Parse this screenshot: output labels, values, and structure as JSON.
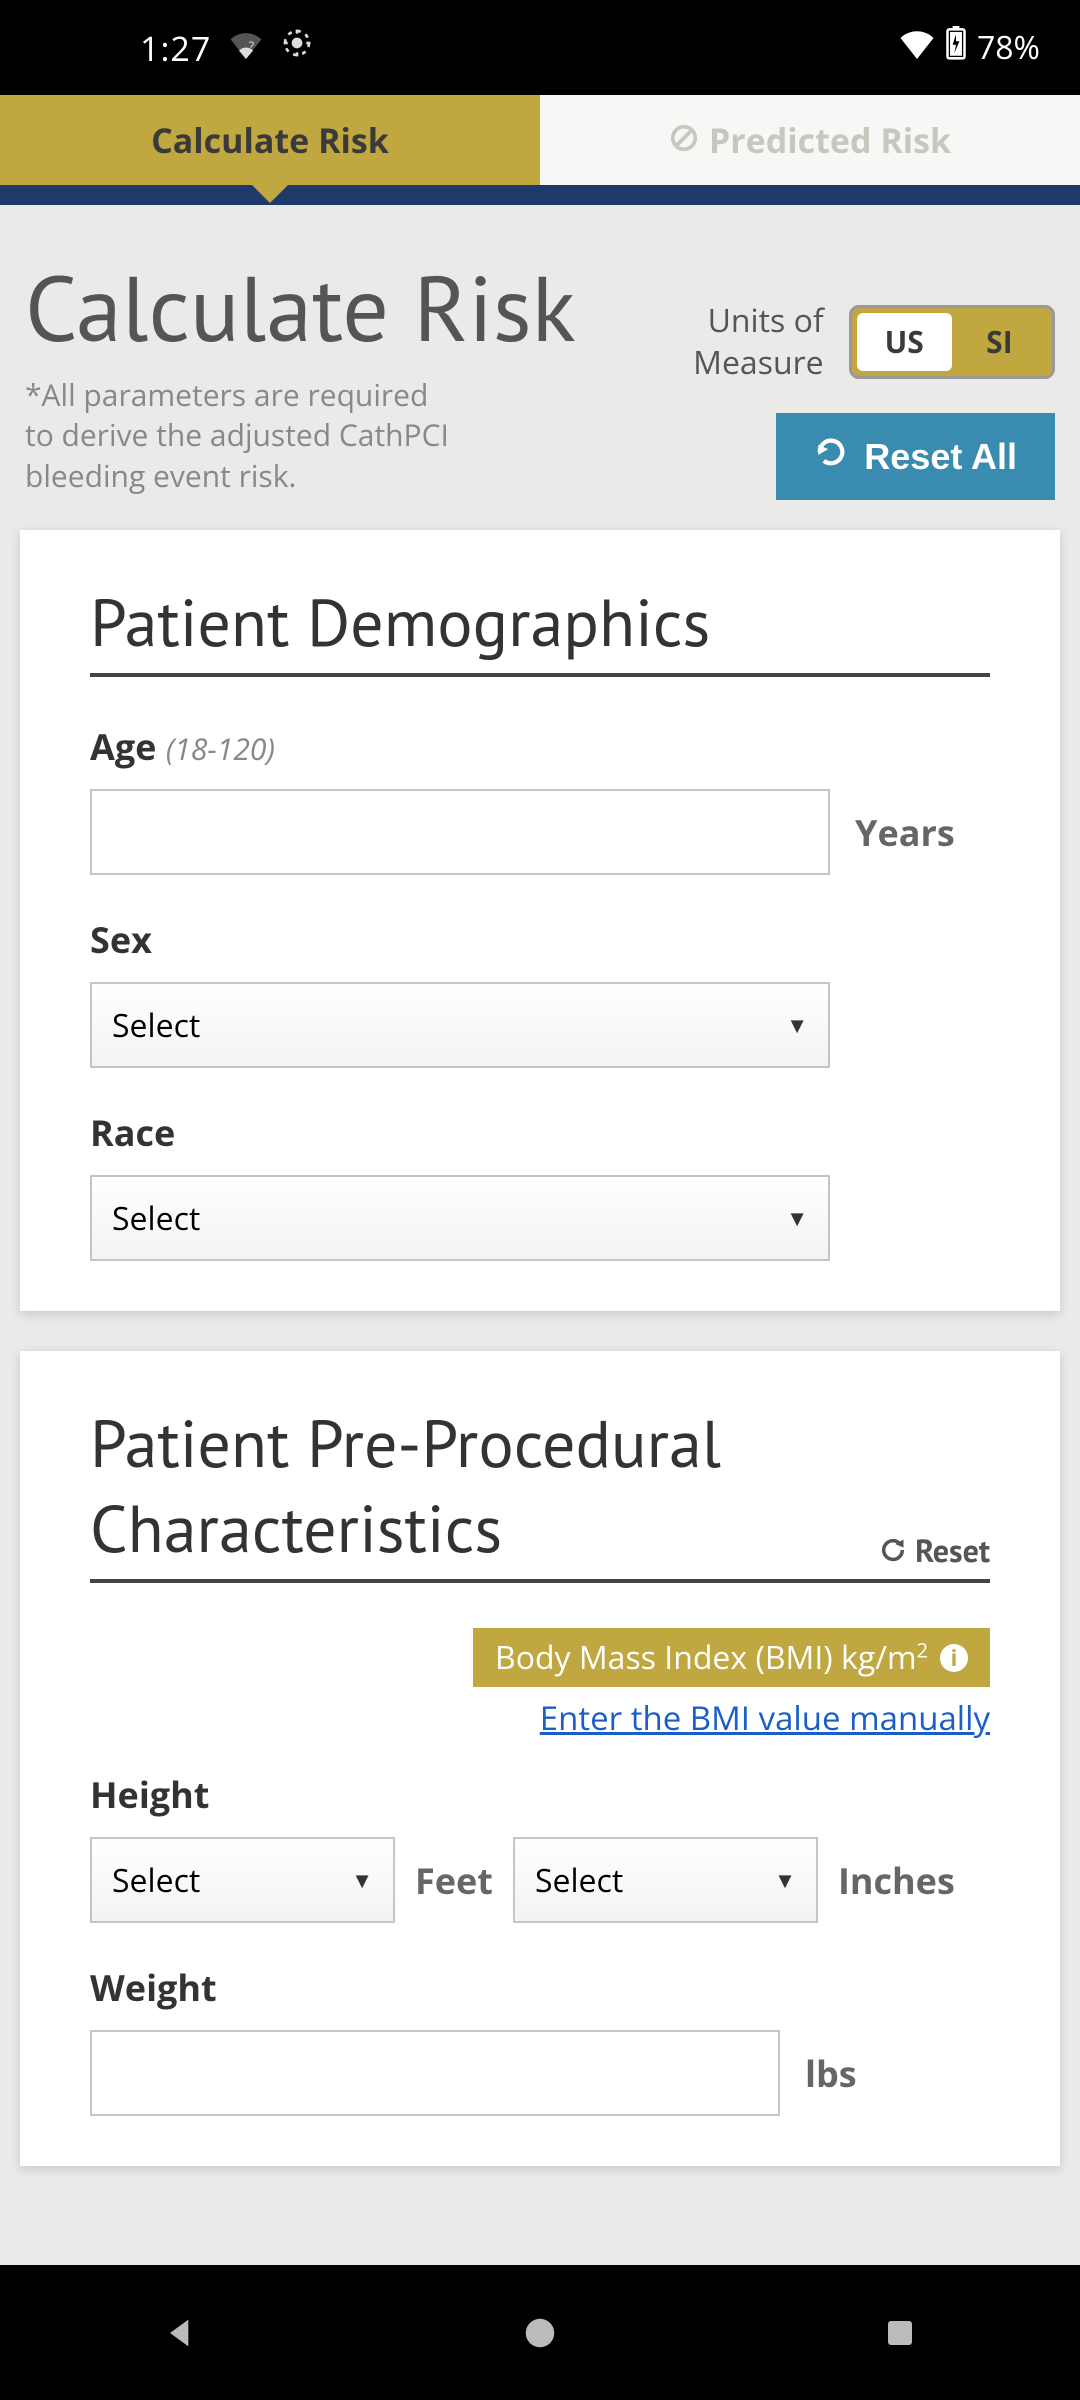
{
  "status": {
    "time": "1:27",
    "battery": "78%"
  },
  "tabs": {
    "calculate": "Calculate Risk",
    "predicted": "Predicted Risk"
  },
  "header": {
    "title": "Calculate Risk",
    "subtitle": "*All parameters are required to derive the adjusted CathPCI bleeding event risk.",
    "units_label": "Units of Measure",
    "unit_us": "US",
    "unit_si": "SI",
    "reset_all": "Reset All"
  },
  "card1": {
    "title": "Patient Demographics",
    "age_label": "Age",
    "age_hint": "(18-120)",
    "age_value": "",
    "age_unit": "Years",
    "sex_label": "Sex",
    "sex_value": "Select",
    "race_label": "Race",
    "race_value": "Select"
  },
  "card2": {
    "title": "Patient Pre-Procedural Characteristics",
    "reset": "Reset",
    "bmi_banner": "Body Mass Index (BMI) kg/m",
    "bmi_exp": "2",
    "manual_link": "Enter the BMI value manually",
    "height_label": "Height",
    "height_ft_value": "Select",
    "height_ft_unit": "Feet",
    "height_in_value": "Select",
    "height_in_unit": "Inches",
    "weight_label": "Weight",
    "weight_value": "",
    "weight_unit": "lbs"
  }
}
